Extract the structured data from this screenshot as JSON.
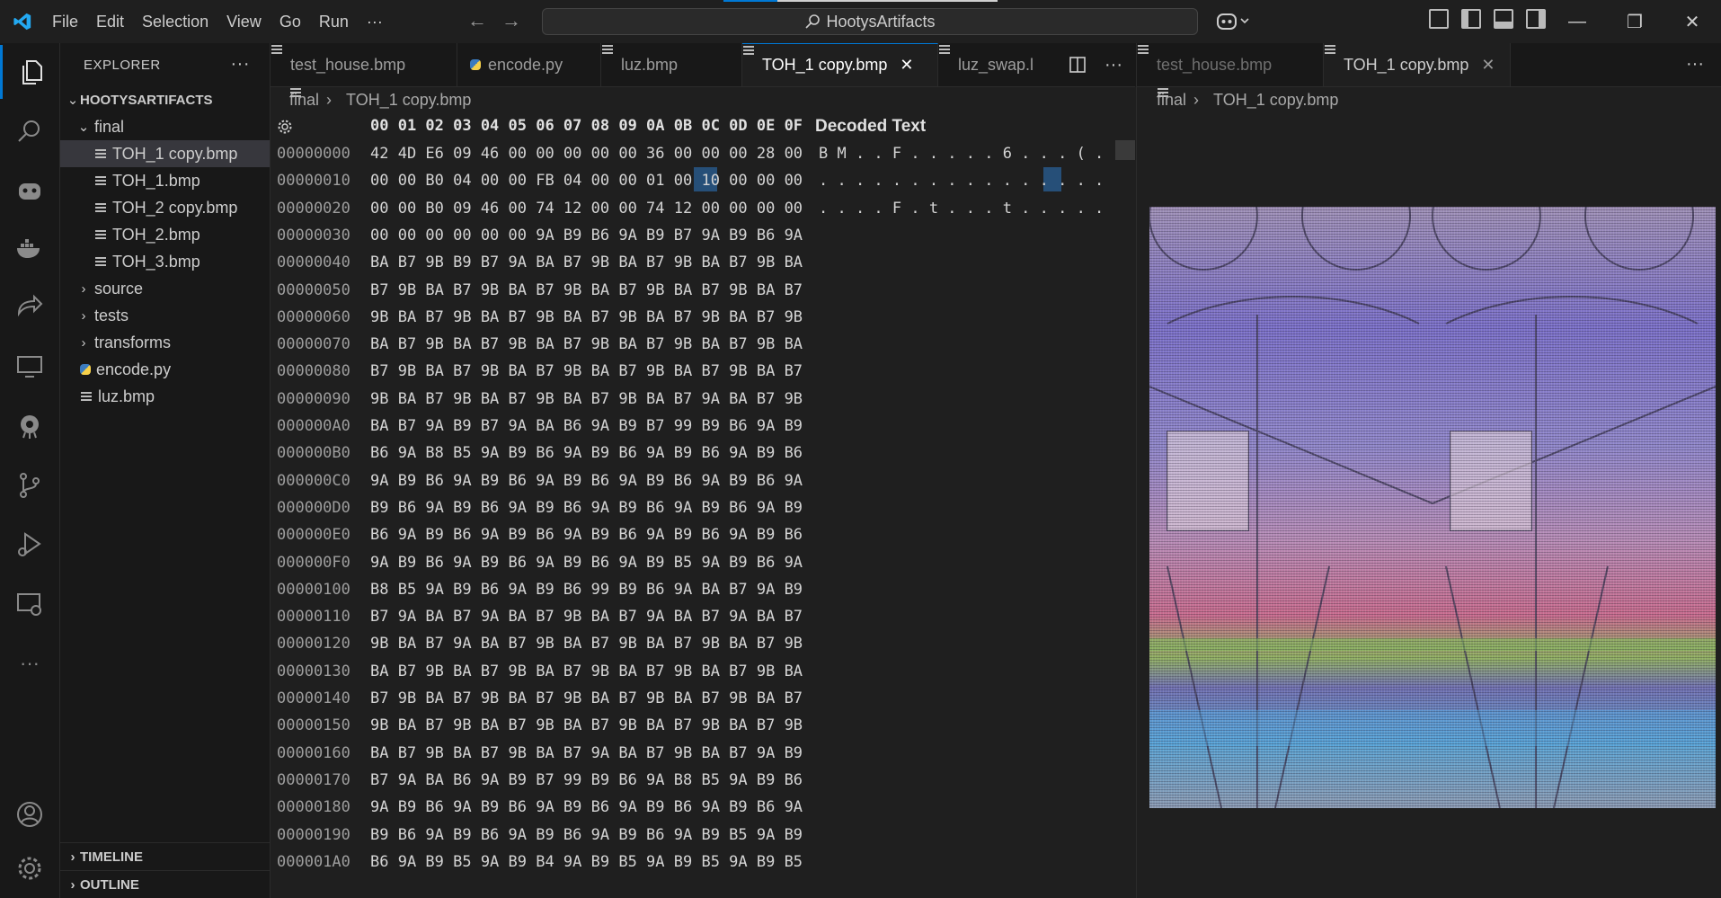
{
  "titlebar": {
    "menus": [
      "File",
      "Edit",
      "Selection",
      "View",
      "Go",
      "Run",
      "···"
    ],
    "search_text": "HootysArtifacts"
  },
  "sidebar": {
    "title": "EXPLORER",
    "more": "···",
    "root": "HOOTYSARTIFACTS",
    "folder_final": "final",
    "final_files": [
      "TOH_1 copy.bmp",
      "TOH_1.bmp",
      "TOH_2 copy.bmp",
      "TOH_2.bmp",
      "TOH_3.bmp"
    ],
    "folders": [
      "source",
      "tests",
      "transforms"
    ],
    "root_files": [
      "encode.py",
      "luz.bmp"
    ],
    "timeline": "TIMELINE",
    "outline": "OUTLINE"
  },
  "editor1": {
    "tabs": [
      "test_house.bmp",
      "encode.py",
      "luz.bmp",
      "TOH_1 copy.bmp",
      "luz_swap.l"
    ],
    "breadcrumb": [
      "final",
      "TOH_1 copy.bmp"
    ],
    "hex_header": "00 01 02 03 04 05 06 07 08 09 0A 0B 0C 0D 0E 0F",
    "decoded_header": "Decoded Text",
    "rows": [
      {
        "off": "00000000",
        "hex": "42 4D E6 09 46 00 00 00 00 00 36 00 00 00 28 00",
        "txt": "B M . . F . . . . . 6 . . . ( ."
      },
      {
        "off": "00000010",
        "hex": "00 00 B0 04 00 00 FB 04 00 00 01 00 10 00 00 00",
        "txt": ". . . . . . . . . . . . . . . ."
      },
      {
        "off": "00000020",
        "hex": "00 00 B0 09 46 00 74 12 00 00 74 12 00 00 00 00",
        "txt": ". . . . F . t . . . t . . . . ."
      },
      {
        "off": "00000030",
        "hex": "00 00 00 00 00 00 9A B9 B6 9A B9 B7 9A B9 B6 9A",
        "txt": ""
      },
      {
        "off": "00000040",
        "hex": "BA B7 9B B9 B7 9A BA B7 9B BA B7 9B BA B7 9B BA",
        "txt": ""
      },
      {
        "off": "00000050",
        "hex": "B7 9B BA B7 9B BA B7 9B BA B7 9B BA B7 9B BA B7",
        "txt": ""
      },
      {
        "off": "00000060",
        "hex": "9B BA B7 9B BA B7 9B BA B7 9B BA B7 9B BA B7 9B",
        "txt": ""
      },
      {
        "off": "00000070",
        "hex": "BA B7 9B BA B7 9B BA B7 9B BA B7 9B BA B7 9B BA",
        "txt": ""
      },
      {
        "off": "00000080",
        "hex": "B7 9B BA B7 9B BA B7 9B BA B7 9B BA B7 9B BA B7",
        "txt": ""
      },
      {
        "off": "00000090",
        "hex": "9B BA B7 9B BA B7 9B BA B7 9B BA B7 9A BA B7 9B",
        "txt": ""
      },
      {
        "off": "000000A0",
        "hex": "BA B7 9A B9 B7 9A BA B6 9A B9 B7 99 B9 B6 9A B9",
        "txt": ""
      },
      {
        "off": "000000B0",
        "hex": "B6 9A B8 B5 9A B9 B6 9A B9 B6 9A B9 B6 9A B9 B6",
        "txt": ""
      },
      {
        "off": "000000C0",
        "hex": "9A B9 B6 9A B9 B6 9A B9 B6 9A B9 B6 9A B9 B6 9A",
        "txt": ""
      },
      {
        "off": "000000D0",
        "hex": "B9 B6 9A B9 B6 9A B9 B6 9A B9 B6 9A B9 B6 9A B9",
        "txt": ""
      },
      {
        "off": "000000E0",
        "hex": "B6 9A B9 B6 9A B9 B6 9A B9 B6 9A B9 B6 9A B9 B6",
        "txt": ""
      },
      {
        "off": "000000F0",
        "hex": "9A B9 B6 9A B9 B6 9A B9 B6 9A B9 B5 9A B9 B6 9A",
        "txt": ""
      },
      {
        "off": "00000100",
        "hex": "B8 B5 9A B9 B6 9A B9 B6 99 B9 B6 9A BA B7 9A B9",
        "txt": ""
      },
      {
        "off": "00000110",
        "hex": "B7 9A BA B7 9A BA B7 9B BA B7 9A BA B7 9A BA B7",
        "txt": ""
      },
      {
        "off": "00000120",
        "hex": "9B BA B7 9A BA B7 9B BA B7 9B BA B7 9B BA B7 9B",
        "txt": ""
      },
      {
        "off": "00000130",
        "hex": "BA B7 9B BA B7 9B BA B7 9B BA B7 9B BA B7 9B BA",
        "txt": ""
      },
      {
        "off": "00000140",
        "hex": "B7 9B BA B7 9B BA B7 9B BA B7 9B BA B7 9B BA B7",
        "txt": ""
      },
      {
        "off": "00000150",
        "hex": "9B BA B7 9B BA B7 9B BA B7 9B BA B7 9B BA B7 9B",
        "txt": ""
      },
      {
        "off": "00000160",
        "hex": "BA B7 9B BA B7 9B BA B7 9A BA B7 9B BA B7 9A B9",
        "txt": ""
      },
      {
        "off": "00000170",
        "hex": "B7 9A BA B6 9A B9 B7 99 B9 B6 9A B8 B5 9A B9 B6",
        "txt": ""
      },
      {
        "off": "00000180",
        "hex": "9A B9 B6 9A B9 B6 9A B9 B6 9A B9 B6 9A B9 B6 9A",
        "txt": ""
      },
      {
        "off": "00000190",
        "hex": "B9 B6 9A B9 B6 9A B9 B6 9A B9 B6 9A B9 B5 9A B9",
        "txt": ""
      },
      {
        "off": "000001A0",
        "hex": "B6 9A B9 B5 9A B9 B4 9A B9 B5 9A B9 B5 9A B9 B5",
        "txt": ""
      }
    ]
  },
  "editor2": {
    "tabs": [
      "test_house.bmp",
      "TOH_1 copy.bmp"
    ],
    "breadcrumb": [
      "final",
      "TOH_1 copy.bmp"
    ],
    "more": "···"
  },
  "colors": {
    "accent": "#0078d4",
    "selection": "#264f78"
  }
}
